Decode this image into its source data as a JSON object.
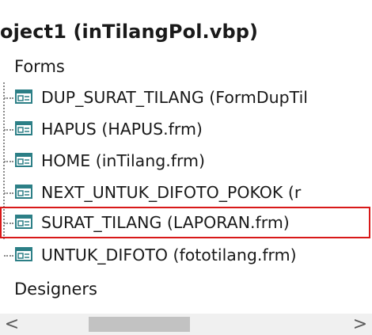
{
  "project": {
    "root_label": "oject1 (inTilangPol.vbp)"
  },
  "tree": {
    "forms_folder": "Forms",
    "items": [
      {
        "label": "DUP_SURAT_TILANG (FormDupTil"
      },
      {
        "label": "HAPUS (HAPUS.frm)"
      },
      {
        "label": "HOME (inTilang.frm)"
      },
      {
        "label": "NEXT_UNTUK_DIFOTO_POKOK (r"
      },
      {
        "label": "SURAT_TILANG (LAPORAN.frm)",
        "selected": true
      },
      {
        "label": "UNTUK_DIFOTO (fototilang.frm)"
      }
    ],
    "designers_folder": "Designers"
  },
  "scrollbar": {
    "left_arrow": "<",
    "right_arrow": ">"
  },
  "colors": {
    "selection_border": "#d81919",
    "form_icon_teal": "#2c7f86"
  },
  "icons": {
    "form_item": "form-icon",
    "scroll_left": "chevron-left-icon",
    "scroll_right": "chevron-right-icon"
  }
}
